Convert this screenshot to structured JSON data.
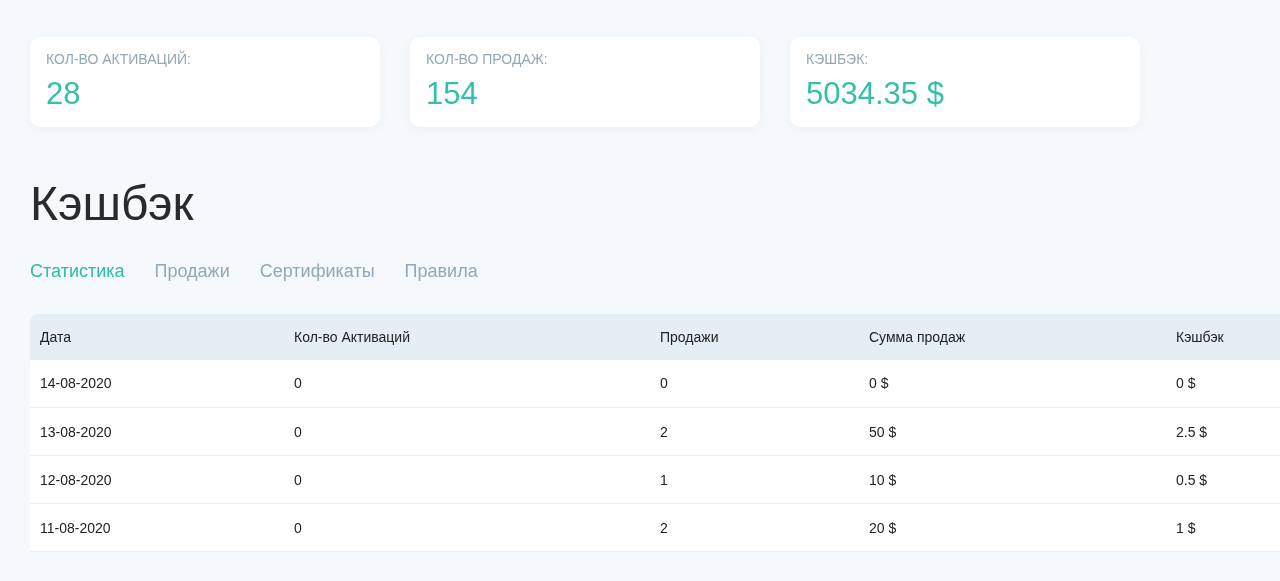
{
  "stats": [
    {
      "label": "КОЛ-ВО АКТИВАЦИЙ:",
      "value": "28"
    },
    {
      "label": "КОЛ-ВО ПРОДАЖ:",
      "value": "154"
    },
    {
      "label": "КЭШБЭК:",
      "value": "5034.35 $"
    }
  ],
  "title": "Кэшбэк",
  "tabs": [
    {
      "label": "Статистика",
      "selected": true
    },
    {
      "label": "Продажи",
      "selected": false
    },
    {
      "label": "Сертификаты",
      "selected": false
    },
    {
      "label": "Правила",
      "selected": false
    }
  ],
  "table": {
    "columns": [
      "Дата",
      "Кол-во Активаций",
      "Продажи",
      "Сумма продаж",
      "Кэшбэк"
    ],
    "rows": [
      [
        "14-08-2020",
        "0",
        "0",
        "0 $",
        "0 $"
      ],
      [
        "13-08-2020",
        "0",
        "2",
        "50 $",
        "2.5 $"
      ],
      [
        "12-08-2020",
        "0",
        "1",
        "10 $",
        "0.5 $"
      ],
      [
        "11-08-2020",
        "0",
        "2",
        "20 $",
        "1 $"
      ]
    ]
  }
}
